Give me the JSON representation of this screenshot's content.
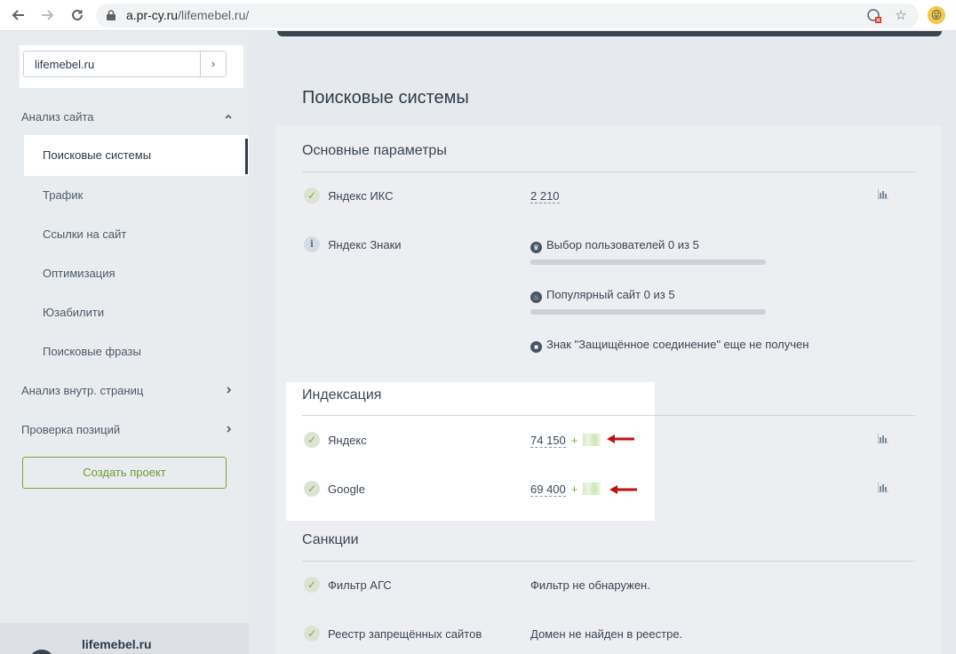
{
  "browser": {
    "url_domain": "a.pr-cy.ru",
    "url_path": "/lifemebel.ru/"
  },
  "sidebar": {
    "domain_value": "lifemebel.ru",
    "go_label": "›",
    "groups": [
      {
        "label": "Анализ сайта"
      },
      {
        "label": "Анализ внутр. страниц"
      },
      {
        "label": "Проверка позиций"
      }
    ],
    "items": [
      {
        "label": "Поисковые системы"
      },
      {
        "label": "Трафик"
      },
      {
        "label": "Ссылки на сайт"
      },
      {
        "label": "Оптимизация"
      },
      {
        "label": "Юзабилити"
      },
      {
        "label": "Поисковые фразы"
      }
    ],
    "create_project": "Создать проект",
    "footer_site": "lifemebel.ru"
  },
  "main": {
    "title": "Поисковые системы",
    "sections": {
      "basic": {
        "title": "Основные параметры",
        "yandex_iks": {
          "label": "Яндекс ИКС",
          "value": "2 210"
        },
        "yandex_signs": {
          "label": "Яндекс Знаки",
          "users_choice": {
            "text": "Выбор пользователей 0 из 5",
            "progress": 0
          },
          "popular": {
            "text": "Популярный сайт 0 из 5",
            "progress": 0
          },
          "secure": {
            "text": "Знак \"Защищённое соединение\" еще не получен"
          }
        }
      },
      "indexing": {
        "title": "Индексация",
        "rows": [
          {
            "label": "Яндекс",
            "value": "74 150",
            "plus": "+"
          },
          {
            "label": "Google",
            "value": "69 400",
            "plus": "+"
          }
        ]
      },
      "sanctions": {
        "title": "Санкции",
        "rows": [
          {
            "label": "Фильтр АГС",
            "value": "Фильтр не обнаружен."
          },
          {
            "label": "Реестр запрещённых сайтов",
            "value": "Домен не найден в реестре."
          }
        ]
      }
    }
  },
  "colors": {
    "accent_green": "#7ab03d",
    "arrow_red": "#c0100f",
    "text_dark": "#2f3c4a"
  }
}
